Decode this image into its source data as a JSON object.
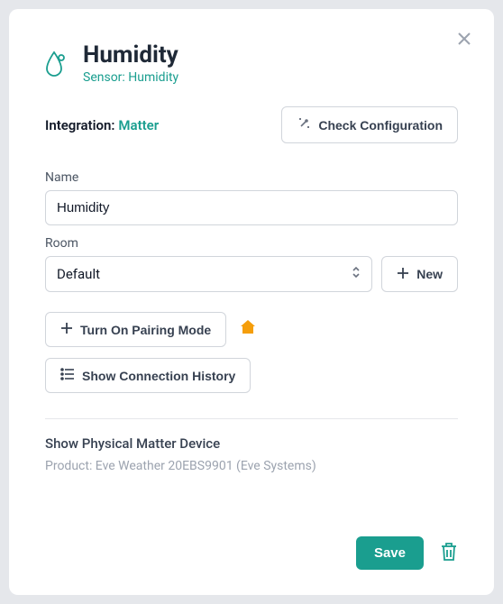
{
  "header": {
    "title": "Humidity",
    "subtitle": "Sensor: Humidity"
  },
  "integration": {
    "label": "Integration:",
    "value": "Matter",
    "check_button": "Check Configuration"
  },
  "fields": {
    "name_label": "Name",
    "name_value": "Humidity",
    "room_label": "Room",
    "room_value": "Default",
    "new_button": "New"
  },
  "actions": {
    "pairing_button": "Turn On Pairing Mode",
    "history_button": "Show Connection History"
  },
  "matter_section": {
    "heading": "Show Physical Matter Device",
    "product": "Product: Eve Weather 20EBS9901 (Eve Systems)"
  },
  "footer": {
    "save_button": "Save"
  }
}
